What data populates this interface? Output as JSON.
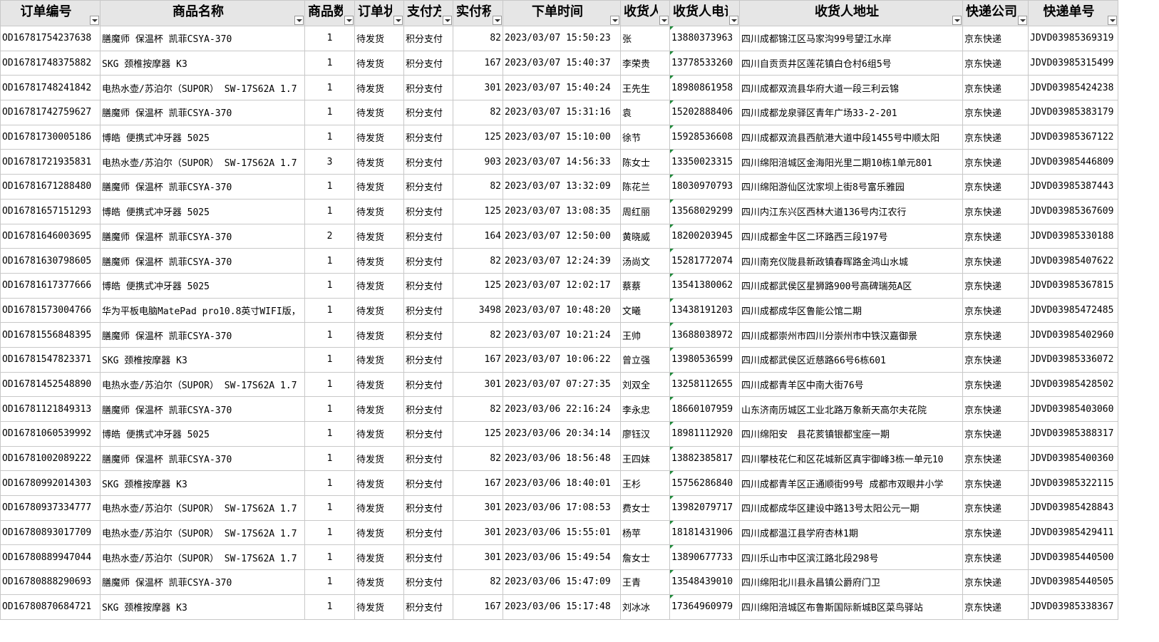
{
  "columns": [
    {
      "label": "订单编号",
      "align": "left"
    },
    {
      "label": "商品名称",
      "align": "left"
    },
    {
      "label": "商品数量",
      "align": "center"
    },
    {
      "label": "订单状态",
      "align": "left"
    },
    {
      "label": "支付方式",
      "align": "left"
    },
    {
      "label": "实付积分",
      "align": "right"
    },
    {
      "label": "下单时间",
      "align": "left"
    },
    {
      "label": "收货人",
      "align": "left"
    },
    {
      "label": "收货人电话",
      "align": "left"
    },
    {
      "label": "收货人地址",
      "align": "left"
    },
    {
      "label": "快递公司",
      "align": "left"
    },
    {
      "label": "快递单号",
      "align": "left"
    }
  ],
  "rows": [
    [
      "OD16781754237638",
      "膳魔师 保温杯 凯菲CSYA-370",
      "1",
      "待发货",
      "积分支付",
      "82",
      "2023/03/07 15:50:23",
      "张",
      "13880373963",
      "四川成都锦江区马家沟99号望江水岸",
      "京东快递",
      "JDVD03985369319"
    ],
    [
      "OD16781748375882",
      "SKG 颈椎按摩器 K3",
      "1",
      "待发货",
      "积分支付",
      "167",
      "2023/03/07 15:40:37",
      "李荣贵",
      "13778533260",
      "四川自贡贡井区莲花镇白仓村6组5号",
      "京东快递",
      "JDVD03985315499"
    ],
    [
      "OD16781748241842",
      "电热水壶/苏泊尔（SUPOR） SW-17S62A 1.7",
      "1",
      "待发货",
      "积分支付",
      "301",
      "2023/03/07 15:40:24",
      "王先生",
      "18980861958",
      "四川成都双流县华府大道一段三利云锦",
      "京东快递",
      "JDVD03985424238"
    ],
    [
      "OD16781742759627",
      "膳魔师 保温杯 凯菲CSYA-370",
      "1",
      "待发货",
      "积分支付",
      "82",
      "2023/03/07 15:31:16",
      "袁",
      "15202888406",
      "四川成都龙泉驿区青年广场33-2-201",
      "京东快递",
      "JDVD03985383179"
    ],
    [
      "OD16781730005186",
      "博皓 便携式冲牙器 5025",
      "1",
      "待发货",
      "积分支付",
      "125",
      "2023/03/07 15:10:00",
      "徐节",
      "15928536608",
      "四川成都双流县西航港大道中段1455号中顺太阳",
      "京东快递",
      "JDVD03985367122"
    ],
    [
      "OD16781721935831",
      "电热水壶/苏泊尔（SUPOR） SW-17S62A 1.7",
      "3",
      "待发货",
      "积分支付",
      "903",
      "2023/03/07 14:56:33",
      "陈女士",
      "13350023315",
      "四川绵阳涪城区金海阳光里二期10栋1单元801",
      "京东快递",
      "JDVD03985446809"
    ],
    [
      "OD16781671288480",
      "膳魔师 保温杯 凯菲CSYA-370",
      "1",
      "待发货",
      "积分支付",
      "82",
      "2023/03/07 13:32:09",
      "陈花兰",
      "18030970793",
      "四川绵阳游仙区沈家坝上街8号富乐雅园",
      "京东快递",
      "JDVD03985387443"
    ],
    [
      "OD16781657151293",
      "博皓 便携式冲牙器 5025",
      "1",
      "待发货",
      "积分支付",
      "125",
      "2023/03/07 13:08:35",
      "周红丽",
      "13568029299",
      "四川内江东兴区西林大道136号内江农行",
      "京东快递",
      "JDVD03985367609"
    ],
    [
      "OD16781646003695",
      "膳魔师 保温杯 凯菲CSYA-370",
      "2",
      "待发货",
      "积分支付",
      "164",
      "2023/03/07 12:50:00",
      "黄晓威",
      "18200203945",
      "四川成都金牛区二环路西三段197号",
      "京东快递",
      "JDVD03985330188"
    ],
    [
      "OD16781630798605",
      "膳魔师 保温杯 凯菲CSYA-370",
      "1",
      "待发货",
      "积分支付",
      "82",
      "2023/03/07 12:24:39",
      "汤尚文",
      "15281772074",
      "四川南充仪陇县新政镇春晖路金鸿山水城",
      "京东快递",
      "JDVD03985407622"
    ],
    [
      "OD16781617377666",
      "博皓 便携式冲牙器 5025",
      "1",
      "待发货",
      "积分支付",
      "125",
      "2023/03/07 12:02:17",
      "蔡蔡",
      "13541380062",
      "四川成都武侯区星狮路900号高碑瑞苑A区",
      "京东快递",
      "JDVD03985367815"
    ],
    [
      "OD16781573004766",
      "华为平板电脑MatePad pro10.8英寸WIFI版，",
      "1",
      "待发货",
      "积分支付",
      "3498",
      "2023/03/07 10:48:20",
      "文曦",
      "13438191203",
      "四川成都成华区鲁能公馆二期",
      "京东快递",
      "JDVD03985472485"
    ],
    [
      "OD16781556848395",
      "膳魔师 保温杯 凯菲CSYA-370",
      "1",
      "待发货",
      "积分支付",
      "82",
      "2023/03/07 10:21:24",
      "王帅",
      "13688038972",
      "四川成都崇州市四川分崇州市中铁汉嘉御景",
      "京东快递",
      "JDVD03985402960"
    ],
    [
      "OD16781547823371",
      "SKG 颈椎按摩器 K3",
      "1",
      "待发货",
      "积分支付",
      "167",
      "2023/03/07 10:06:22",
      "曾立强",
      "13980536599",
      "四川成都武侯区近慈路66号6栋601",
      "京东快递",
      "JDVD03985336072"
    ],
    [
      "OD16781452548890",
      "电热水壶/苏泊尔（SUPOR） SW-17S62A 1.7",
      "1",
      "待发货",
      "积分支付",
      "301",
      "2023/03/07 07:27:35",
      "刘双全",
      "13258112655",
      "四川成都青羊区中南大街76号",
      "京东快递",
      "JDVD03985428502"
    ],
    [
      "OD16781121849313",
      "膳魔师 保温杯 凯菲CSYA-370",
      "1",
      "待发货",
      "积分支付",
      "82",
      "2023/03/06 22:16:24",
      "李永忠",
      "18660107959",
      "山东济南历城区工业北路万象新天高尔夫花院",
      "京东快递",
      "JDVD03985403060"
    ],
    [
      "OD16781060539992",
      "博皓 便携式冲牙器 5025",
      "1",
      "待发货",
      "积分支付",
      "125",
      "2023/03/06 20:34:14",
      "廖钰汉",
      "18981112920",
      "四川绵阳安　县花荄镇银都宝座一期",
      "京东快递",
      "JDVD03985388317"
    ],
    [
      "OD16781002089222",
      "膳魔师 保温杯 凯菲CSYA-370",
      "1",
      "待发货",
      "积分支付",
      "82",
      "2023/03/06 18:56:48",
      "王四妹",
      "13882385817",
      "四川攀枝花仁和区花城新区真宇御峰3栋一单元10",
      "京东快递",
      "JDVD03985400360"
    ],
    [
      "OD16780992014303",
      "SKG 颈椎按摩器 K3",
      "1",
      "待发货",
      "积分支付",
      "167",
      "2023/03/06 18:40:01",
      "王杉",
      "15756286840",
      "四川成都青羊区正通顺街99号 成都市双眼井小学",
      "京东快递",
      "JDVD03985322115"
    ],
    [
      "OD16780937334777",
      "电热水壶/苏泊尔（SUPOR） SW-17S62A 1.7",
      "1",
      "待发货",
      "积分支付",
      "301",
      "2023/03/06 17:08:53",
      "费女士",
      "13982079717",
      "四川成都成华区建设中路13号太阳公元一期",
      "京东快递",
      "JDVD03985428843"
    ],
    [
      "OD16780893017709",
      "电热水壶/苏泊尔（SUPOR） SW-17S62A 1.7",
      "1",
      "待发货",
      "积分支付",
      "301",
      "2023/03/06 15:55:01",
      "杨苹",
      "18181431906",
      "四川成都温江县学府杏林1期",
      "京东快递",
      "JDVD03985429411"
    ],
    [
      "OD16780889947044",
      "电热水壶/苏泊尔（SUPOR） SW-17S62A 1.7",
      "1",
      "待发货",
      "积分支付",
      "301",
      "2023/03/06 15:49:54",
      "詹女士",
      "13890677733",
      "四川乐山市中区滨江路北段298号",
      "京东快递",
      "JDVD03985440500"
    ],
    [
      "OD16780888290693",
      "膳魔师 保温杯 凯菲CSYA-370",
      "1",
      "待发货",
      "积分支付",
      "82",
      "2023/03/06 15:47:09",
      "王青",
      "13548439010",
      "四川绵阳北川县永昌镇公爵府门卫",
      "京东快递",
      "JDVD03985440505"
    ],
    [
      "OD16780870684721",
      "SKG 颈椎按摩器 K3",
      "1",
      "待发货",
      "积分支付",
      "167",
      "2023/03/06 15:17:48",
      "刘冰冰",
      "17364960979",
      "四川绵阳涪城区布鲁斯国际新城B区菜鸟驿站",
      "京东快递",
      "JDVD03985338367"
    ]
  ],
  "colors": {
    "header_bg": "#e6e6e6",
    "grid": "#c8c8c8",
    "comment_marker": "#1f8a3a"
  }
}
